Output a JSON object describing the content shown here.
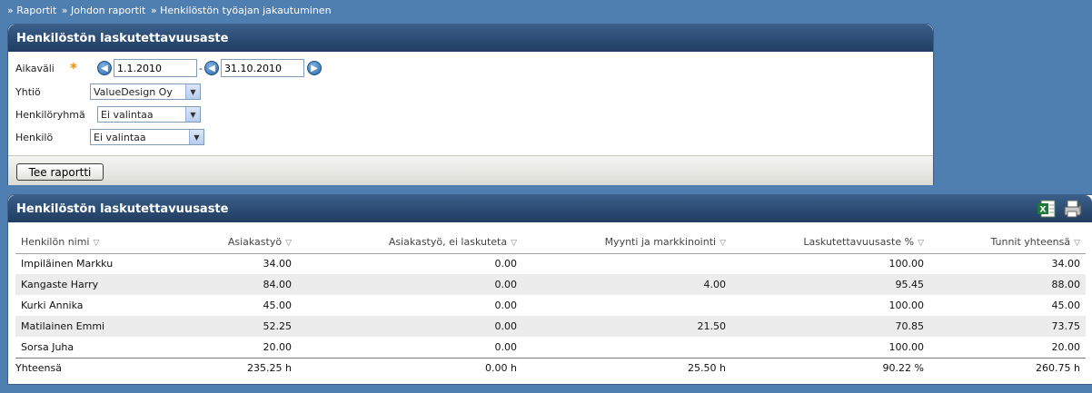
{
  "breadcrumb": [
    "» Raportit",
    "» Johdon raportit",
    "» Henkilöstön työajan jakautuminen"
  ],
  "filter_panel": {
    "title": "Henkilöstön laskutettavuusaste",
    "date_label": "Aikaväli",
    "required_mark": "*",
    "date_from": "1.1.2010",
    "date_separator": "-",
    "date_to": "31.10.2010",
    "company_label": "Yhtiö",
    "company_value": "ValueDesign Oy",
    "group_label": "Henkilöryhmä",
    "group_value": "Ei valintaa",
    "person_label": "Henkilö",
    "person_value": "Ei valintaa",
    "submit_label": "Tee raportti"
  },
  "report_panel": {
    "title": "Henkilöstön laskutettavuusaste",
    "columns": [
      "Henkilön nimi",
      "Asiakastyö",
      "Asiakastyö, ei laskuteta",
      "Myynti ja markkinointi",
      "Laskutettavuusaste %",
      "Tunnit yhteensä"
    ],
    "rows": [
      [
        "Impiläinen Markku",
        "34.00",
        "0.00",
        "",
        "100.00",
        "34.00"
      ],
      [
        "Kangaste Harry",
        "84.00",
        "0.00",
        "4.00",
        "95.45",
        "88.00"
      ],
      [
        "Kurki Annika",
        "45.00",
        "0.00",
        "",
        "100.00",
        "45.00"
      ],
      [
        "Matilainen Emmi",
        "52.25",
        "0.00",
        "21.50",
        "70.85",
        "73.75"
      ],
      [
        "Sorsa Juha",
        "20.00",
        "0.00",
        "",
        "100.00",
        "20.00"
      ]
    ],
    "totals": [
      "Yhteensä",
      "235.25 h",
      "0.00 h",
      "25.50 h",
      "90.22 %",
      "260.75 h"
    ]
  },
  "icons": {
    "sort": "sort-down-icon",
    "prev": "arrow-left-icon",
    "next": "arrow-right-icon",
    "excel": "excel-icon",
    "print": "print-icon"
  }
}
